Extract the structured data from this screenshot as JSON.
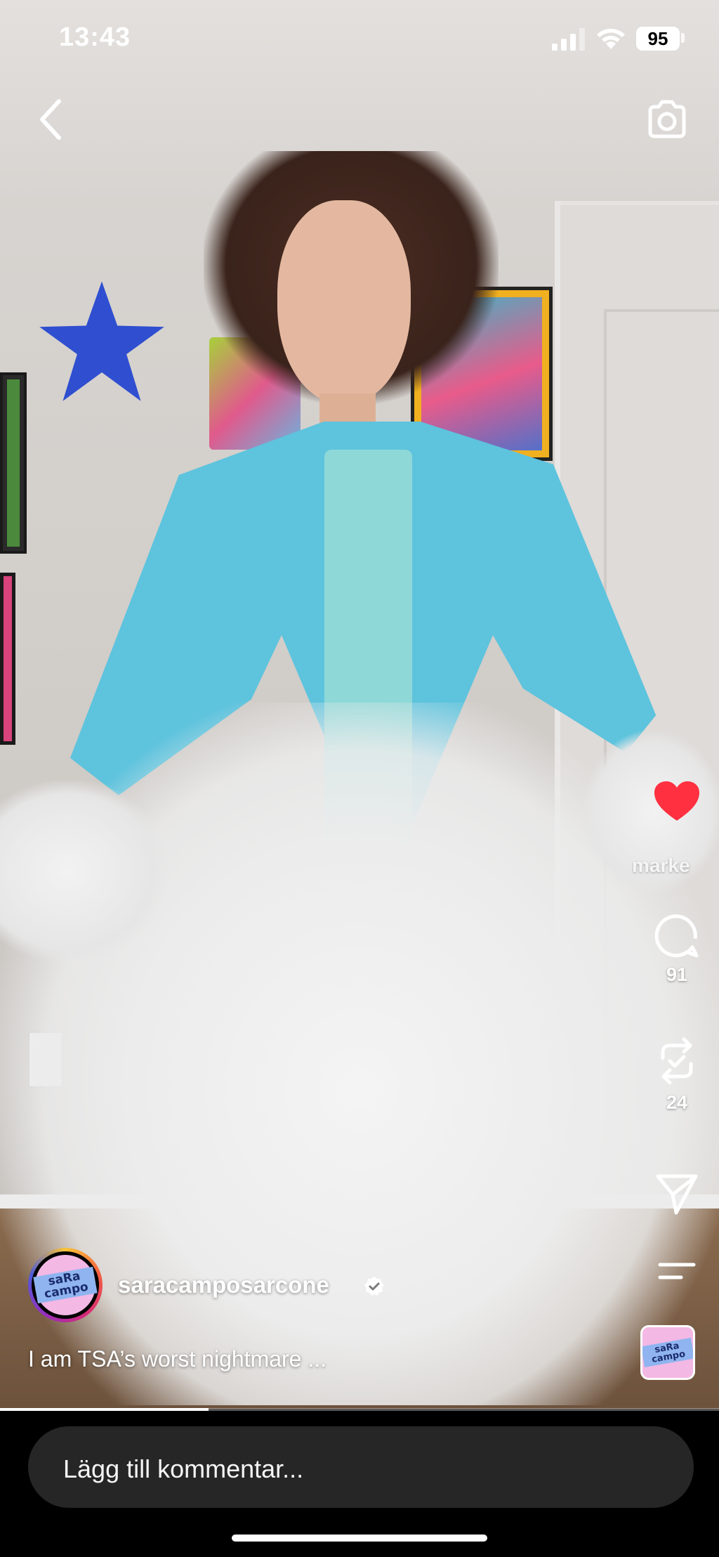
{
  "status_bar": {
    "time": "13:43",
    "battery": "95"
  },
  "nav": {
    "back_icon": "chevron-left-icon",
    "camera_icon": "camera-icon"
  },
  "actions": {
    "like_label": "marke",
    "like_color": "#ff3040",
    "comments_count": "91",
    "reposts_count": "24"
  },
  "author": {
    "username": "saracamposarcone",
    "verified": true,
    "avatar_text": "saRa campo"
  },
  "caption": "I am TSA’s worst nightmare ...",
  "audio": {
    "thumb_text": "saRa campo"
  },
  "playback": {
    "progress_fraction": 0.29
  },
  "comment": {
    "placeholder": "Lägg till kommentar..."
  }
}
